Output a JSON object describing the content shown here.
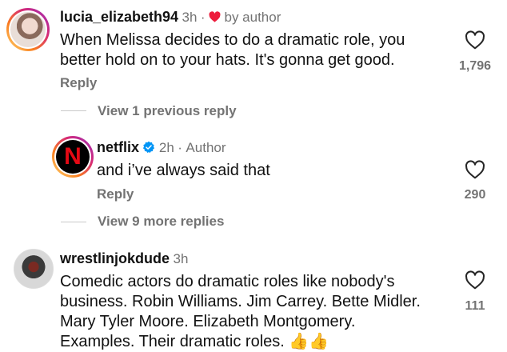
{
  "comments": [
    {
      "username": "lucia_elizabeth94",
      "time": "3h",
      "separator": "·",
      "liked_by_author": "by author",
      "text_lines": [
        "When Melissa decides to do a dramatic role, you",
        "better hold on to your hats. It's gonna get good."
      ],
      "reply_label": "Reply",
      "like_count": "1,796"
    },
    {
      "username": "netflix",
      "time": "2h",
      "separator": "·",
      "badge": "Author",
      "text_lines": [
        "and i’ve always said that"
      ],
      "reply_label": "Reply",
      "like_count": "290",
      "avatar_letter": "N"
    },
    {
      "username": "wrestlinjokdude",
      "time": "3h",
      "text_lines": [
        "Comedic actors do dramatic roles like nobody's",
        "business. Robin Williams. Jim Carrey. Bette Midler.",
        "Mary Tyler Moore. Elizabeth Montgomery.",
        "Examples. Their dramatic roles. 👍👍"
      ],
      "like_count": "111"
    }
  ],
  "threads": {
    "view_previous": "View 1 previous reply",
    "view_more": "View 9 more replies"
  },
  "colors": {
    "heart_red": "#ed1c3c",
    "verified_blue": "#0095f6",
    "netflix_red": "#e50914"
  }
}
